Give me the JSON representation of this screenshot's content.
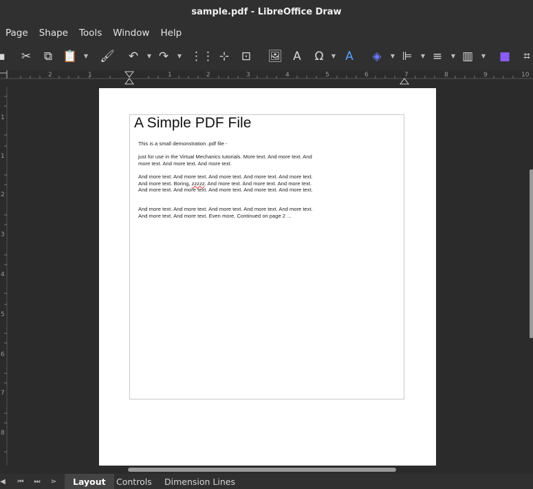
{
  "window": {
    "title": "sample.pdf - LibreOffice Draw"
  },
  "menu": [
    "Page",
    "Shape",
    "Tools",
    "Window",
    "Help"
  ],
  "toolbar": {
    "icons": [
      {
        "name": "cut-icon",
        "glyph": "✂"
      },
      {
        "name": "copy-icon",
        "glyph": "⧉"
      },
      {
        "name": "paste-icon",
        "glyph": "📋"
      },
      {
        "name": "clone-formatting-icon",
        "glyph": "🖌"
      },
      {
        "name": "undo-icon",
        "glyph": "↶"
      },
      {
        "name": "redo-icon",
        "glyph": "↷"
      },
      {
        "name": "grid-icon",
        "glyph": "⋮⋮"
      },
      {
        "name": "helplines-icon",
        "glyph": "⊹"
      },
      {
        "name": "zoom-pan-icon",
        "glyph": "⊡"
      },
      {
        "name": "insert-image-icon",
        "glyph": "🖼"
      },
      {
        "name": "insert-textbox-icon",
        "glyph": "A"
      },
      {
        "name": "special-character-icon",
        "glyph": "Ω"
      },
      {
        "name": "fontwork-icon",
        "glyph": "A"
      },
      {
        "name": "transformations-icon",
        "glyph": "◈"
      },
      {
        "name": "align-objects-icon",
        "glyph": "⊫"
      },
      {
        "name": "arrange-icon",
        "glyph": "≡"
      },
      {
        "name": "distribute-icon",
        "glyph": "▥"
      },
      {
        "name": "shadow-icon",
        "glyph": "■"
      },
      {
        "name": "crop-icon",
        "glyph": "⌗"
      }
    ]
  },
  "ruler": {
    "h_numbers": [
      "2",
      "1",
      "1",
      "2",
      "3",
      "4",
      "5",
      "6",
      "7",
      "8",
      "9",
      "10"
    ],
    "v_numbers": [
      "1",
      "1",
      "2",
      "3",
      "4",
      "5",
      "6",
      "7",
      "8"
    ]
  },
  "document": {
    "title": "A Simple PDF File",
    "p1": "This is a small demonstration .pdf file -",
    "p2": "just for use in the Virtual Mechanics tutorials. More text. And more text. And more text. And more text. And more text.",
    "p3_a": "And more text. And more text. And more text. And more text. And more text. And more text. Boring, ",
    "p3_squiggle": "zzzzz",
    "p3_b": ". And more text. And more text. And more text. And more text. And more text. And more text. And more text. And more text.",
    "p4": "And more text. And more text. And more text. And more text. And more text. And more text. And more text. Even more. Continued on page 2 ..."
  },
  "tabs": [
    {
      "label": "Layout",
      "active": true
    },
    {
      "label": "Controls",
      "active": false
    },
    {
      "label": "Dimension Lines",
      "active": false
    }
  ],
  "nav": [
    "first-icon",
    "prev-icon",
    "next-icon",
    "last-icon"
  ]
}
